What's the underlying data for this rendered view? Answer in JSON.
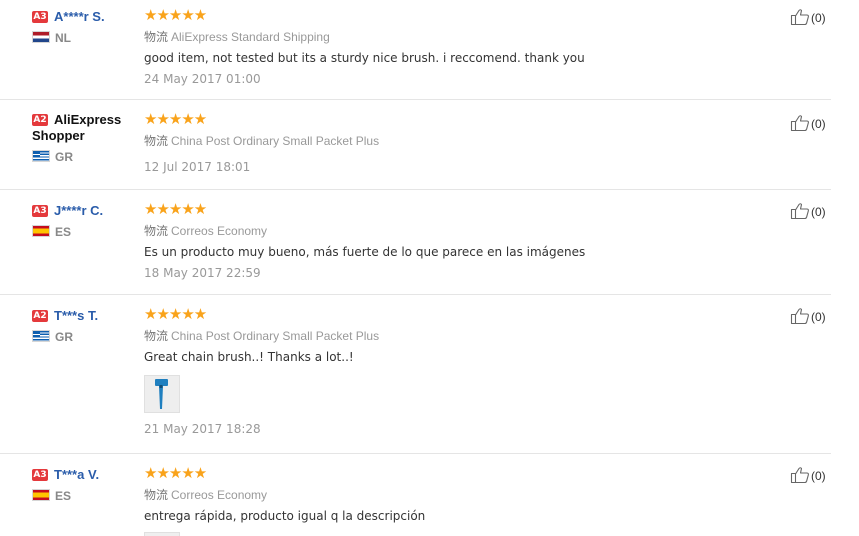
{
  "logistics_label": "物流",
  "reviews": [
    {
      "level": "A3",
      "name": "A****r S.",
      "country": "NL",
      "stars": "★★★★★",
      "shipping": "AliExpress Standard Shipping",
      "feedback": "good item, not tested but its a sturdy nice brush. i reccomend. thank you",
      "date": "24 May 2017 01:00",
      "helpful_count": "(0)"
    },
    {
      "level": "A2",
      "name": "AliExpress Shopper",
      "country": "GR",
      "stars": "★★★★★",
      "shipping": "China Post Ordinary Small Packet Plus",
      "feedback": "",
      "date": "12 Jul 2017 18:01",
      "helpful_count": "(0)"
    },
    {
      "level": "A3",
      "name": "J****r C.",
      "country": "ES",
      "stars": "★★★★★",
      "shipping": "Correos Economy",
      "feedback": "Es un producto muy bueno, más fuerte de lo que parece en las imágenes",
      "date": "18 May 2017 22:59",
      "helpful_count": "(0)"
    },
    {
      "level": "A2",
      "name": "T***s T.",
      "country": "GR",
      "stars": "★★★★★",
      "shipping": "China Post Ordinary Small Packet Plus",
      "feedback": "Great chain brush..! Thanks a lot..!",
      "date": "21 May 2017 18:28",
      "helpful_count": "(0)"
    },
    {
      "level": "A3",
      "name": "T***a V.",
      "country": "ES",
      "stars": "★★★★★",
      "shipping": "Correos Economy",
      "feedback": "entrega rápida, producto igual q la descripción",
      "date": "",
      "helpful_count": "(0)"
    }
  ],
  "colors": {
    "star": "#f9a31b",
    "username": "#2a5caa",
    "level_badge": "#e4393c",
    "muted_text": "#999999"
  },
  "icons": {
    "rating": "star-icon",
    "helpful": "thumbs-up-icon",
    "flag_nl": "flag-netherlands-icon",
    "flag_gr": "flag-greece-icon",
    "flag_es": "flag-spain-icon"
  }
}
